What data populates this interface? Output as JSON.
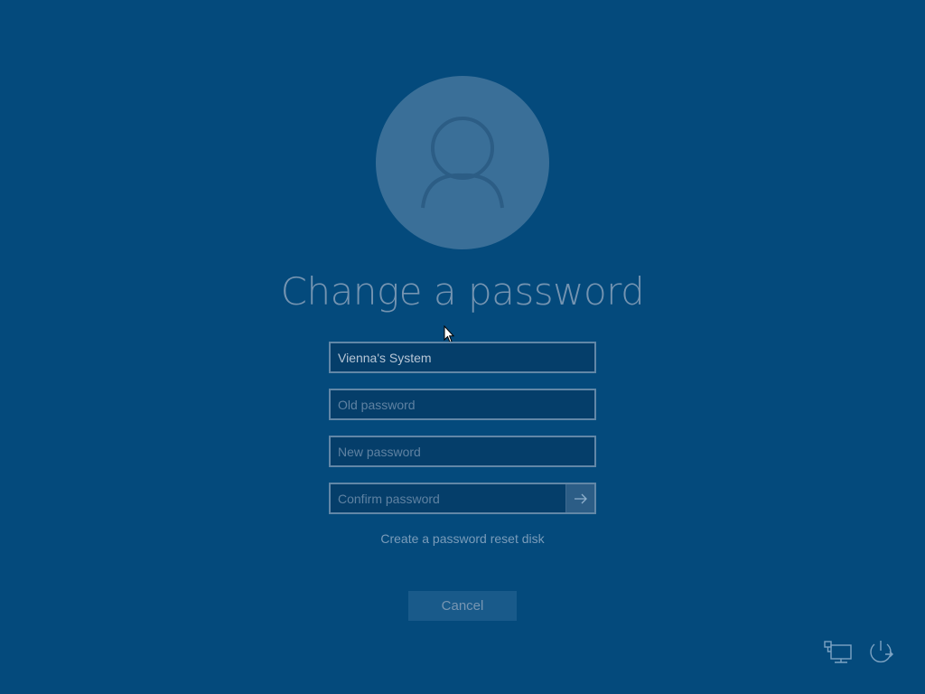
{
  "page": {
    "title": "Change a password"
  },
  "avatar": {
    "icon": "user-icon"
  },
  "form": {
    "username_value": "Vienna's System",
    "old_password_placeholder": "Old password",
    "new_password_placeholder": "New password",
    "confirm_password_placeholder": "Confirm password",
    "submit_icon": "arrow-right-icon"
  },
  "links": {
    "reset_disk": "Create a password reset disk"
  },
  "buttons": {
    "cancel": "Cancel"
  },
  "corner": {
    "network_icon": "network-icon",
    "power_icon": "power-icon"
  },
  "colors": {
    "background": "#044a7c",
    "avatar": "#3a6f98",
    "field_border": "#6287a7",
    "text_muted": "#7594b1"
  }
}
